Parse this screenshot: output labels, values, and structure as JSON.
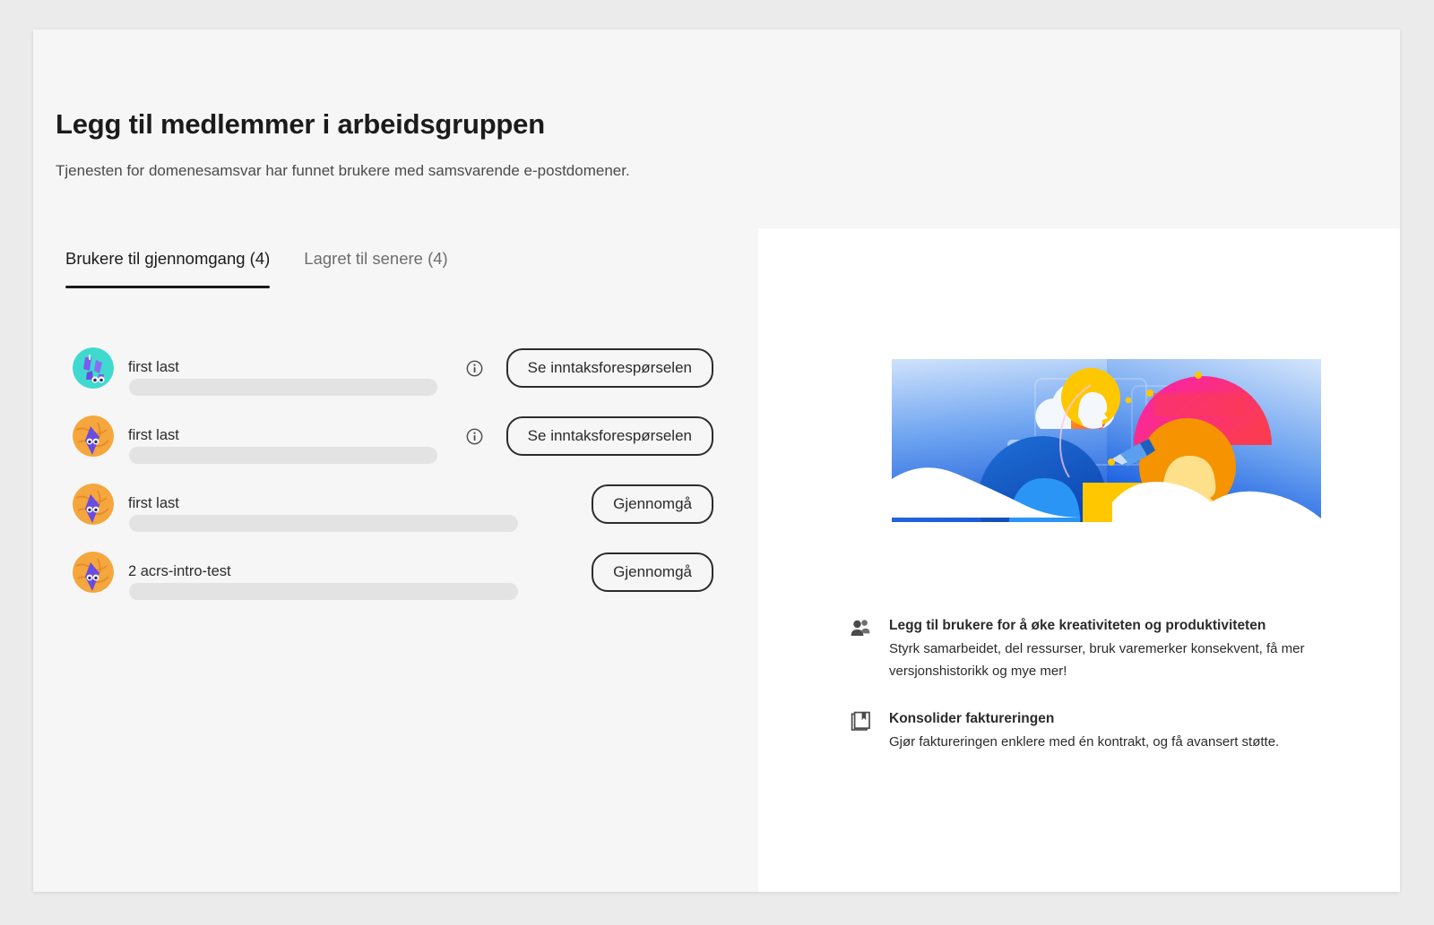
{
  "header": {
    "title": "Legg til medlemmer i arbeidsgruppen",
    "subtitle": "Tjenesten for domenesamsvar har funnet brukere med samsvarende e-postdomener."
  },
  "tabs": [
    {
      "label": "Brukere til gjennomgang (4)",
      "active": true
    },
    {
      "label": "Lagret til senere (4)",
      "active": false
    }
  ],
  "users": [
    {
      "name": "first last",
      "email": "",
      "avatar_icon": "avatar-teal-purple",
      "info_icon": "info-circle-icon",
      "has_info": true,
      "action_label": "Se inntaksforespørselen"
    },
    {
      "name": "first last",
      "email": "",
      "avatar_icon": "avatar-orange-purple",
      "info_icon": "info-circle-icon",
      "has_info": true,
      "action_label": "Se inntaksforespørselen"
    },
    {
      "name": "first last",
      "email": "",
      "avatar_icon": "avatar-orange-purple",
      "info_icon": "",
      "has_info": false,
      "action_label": "Gjennomgå"
    },
    {
      "name": "2 acrs-intro-test",
      "email": "",
      "avatar_icon": "avatar-orange-purple",
      "info_icon": "",
      "has_info": false,
      "action_label": "Gjennomgå"
    }
  ],
  "promo": {
    "illustration_name": "collaboration-hero-illustration",
    "benefits": [
      {
        "icon": "users-silhouette-icon",
        "title": "Legg til brukere for å øke kreativiteten og produktiviteten",
        "description": "Styrk samarbeidet, del ressurser, bruk varemerker konsekvent, få mer versjonshistorikk og mye mer!"
      },
      {
        "icon": "book-icon",
        "title": "Konsolider faktureringen",
        "description": "Gjør faktureringen enklere med én kontrakt, og få avansert støtte."
      }
    ]
  },
  "colors": {
    "page_background": "#ebebeb",
    "card_background": "#f6f6f7",
    "panel_background": "#ffffff",
    "text_primary": "#1b1b1b",
    "text_secondary": "#6d6d6d",
    "redaction_bar": "#e3e3e3",
    "illustration_blue": "#1473e6",
    "illustration_pink": "#f424a0",
    "illustration_yellow": "#ffc700",
    "illustration_orange": "#f59300"
  }
}
